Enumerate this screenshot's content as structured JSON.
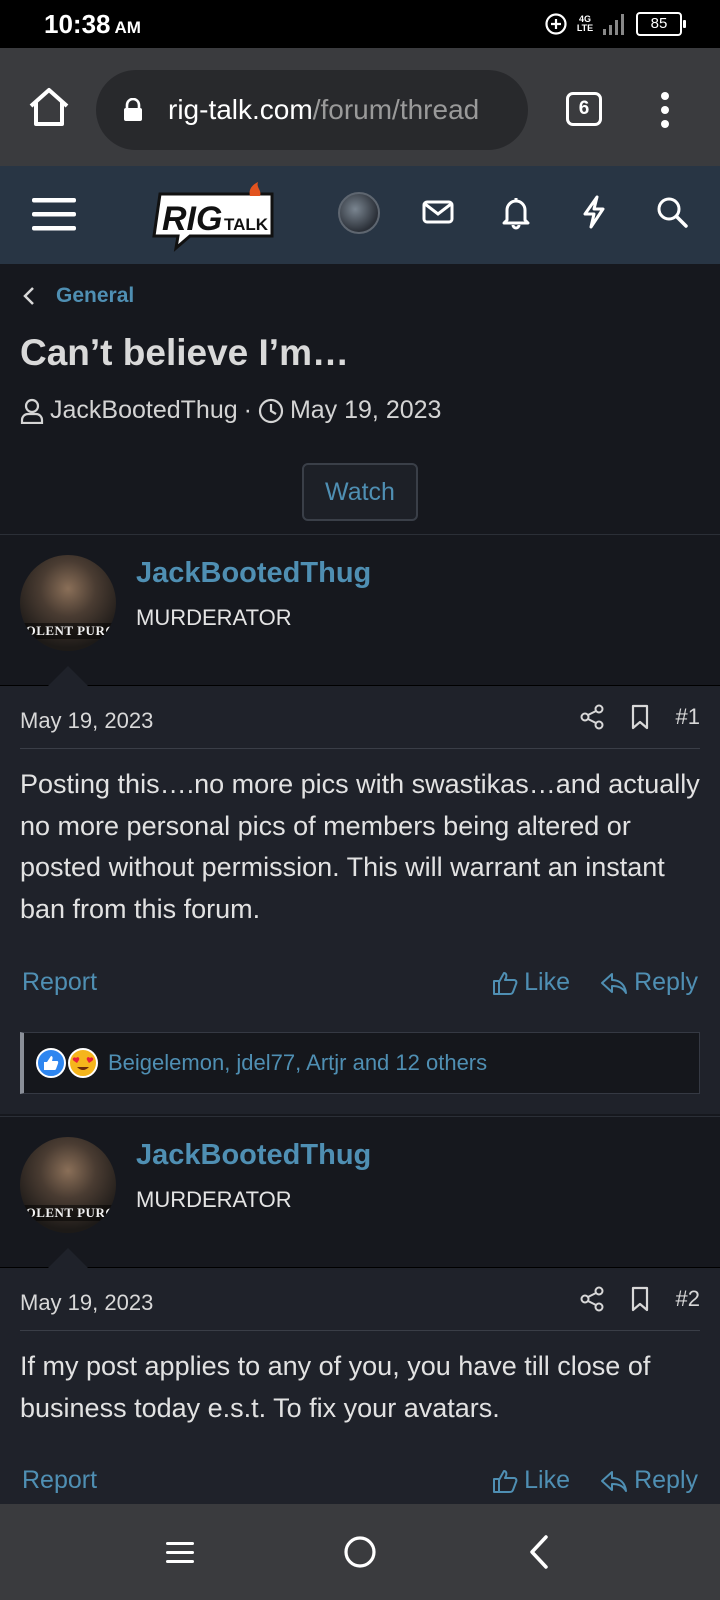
{
  "status_bar": {
    "time": "10:38",
    "ampm": "AM",
    "network": "4G LTE",
    "battery": "85"
  },
  "browser": {
    "url_domain": "rig-talk.com",
    "url_path": "/forum/thread",
    "tab_count": "6"
  },
  "site": {
    "logo_text": "RIG",
    "logo_sub": "TALK"
  },
  "thread": {
    "breadcrumb": "General",
    "title": "Can’t believe I’m…",
    "author": "JackBootedThug",
    "separator": "·",
    "date": "May 19, 2023",
    "watch_label": "Watch"
  },
  "posts": [
    {
      "username": "JackBootedThug",
      "role": "MURDERATOR",
      "avatar_text": "IOLENT PURG",
      "date": "May 19, 2023",
      "number": "#1",
      "text": "Posting this….no more pics with swastikas…and actually no more personal pics of members being altered or posted without permission. This will warrant an instant ban from this forum.",
      "report_label": "Report",
      "like_label": "Like",
      "reply_label": "Reply",
      "reactions": "Beigelemon, jdel77, Artjr and 12 others"
    },
    {
      "username": "JackBootedThug",
      "role": "MURDERATOR",
      "avatar_text": "IOLENT PURG",
      "date": "May 19, 2023",
      "number": "#2",
      "text": "If my post applies to any of you, you have till close of business today e.s.t. To fix your avatars.",
      "report_label": "Report",
      "like_label": "Like",
      "reply_label": "Reply"
    }
  ],
  "colors": {
    "link": "#4f8fb3",
    "header_bg": "#283544",
    "post_bg": "#1f222a",
    "page_bg": "#16181e"
  }
}
